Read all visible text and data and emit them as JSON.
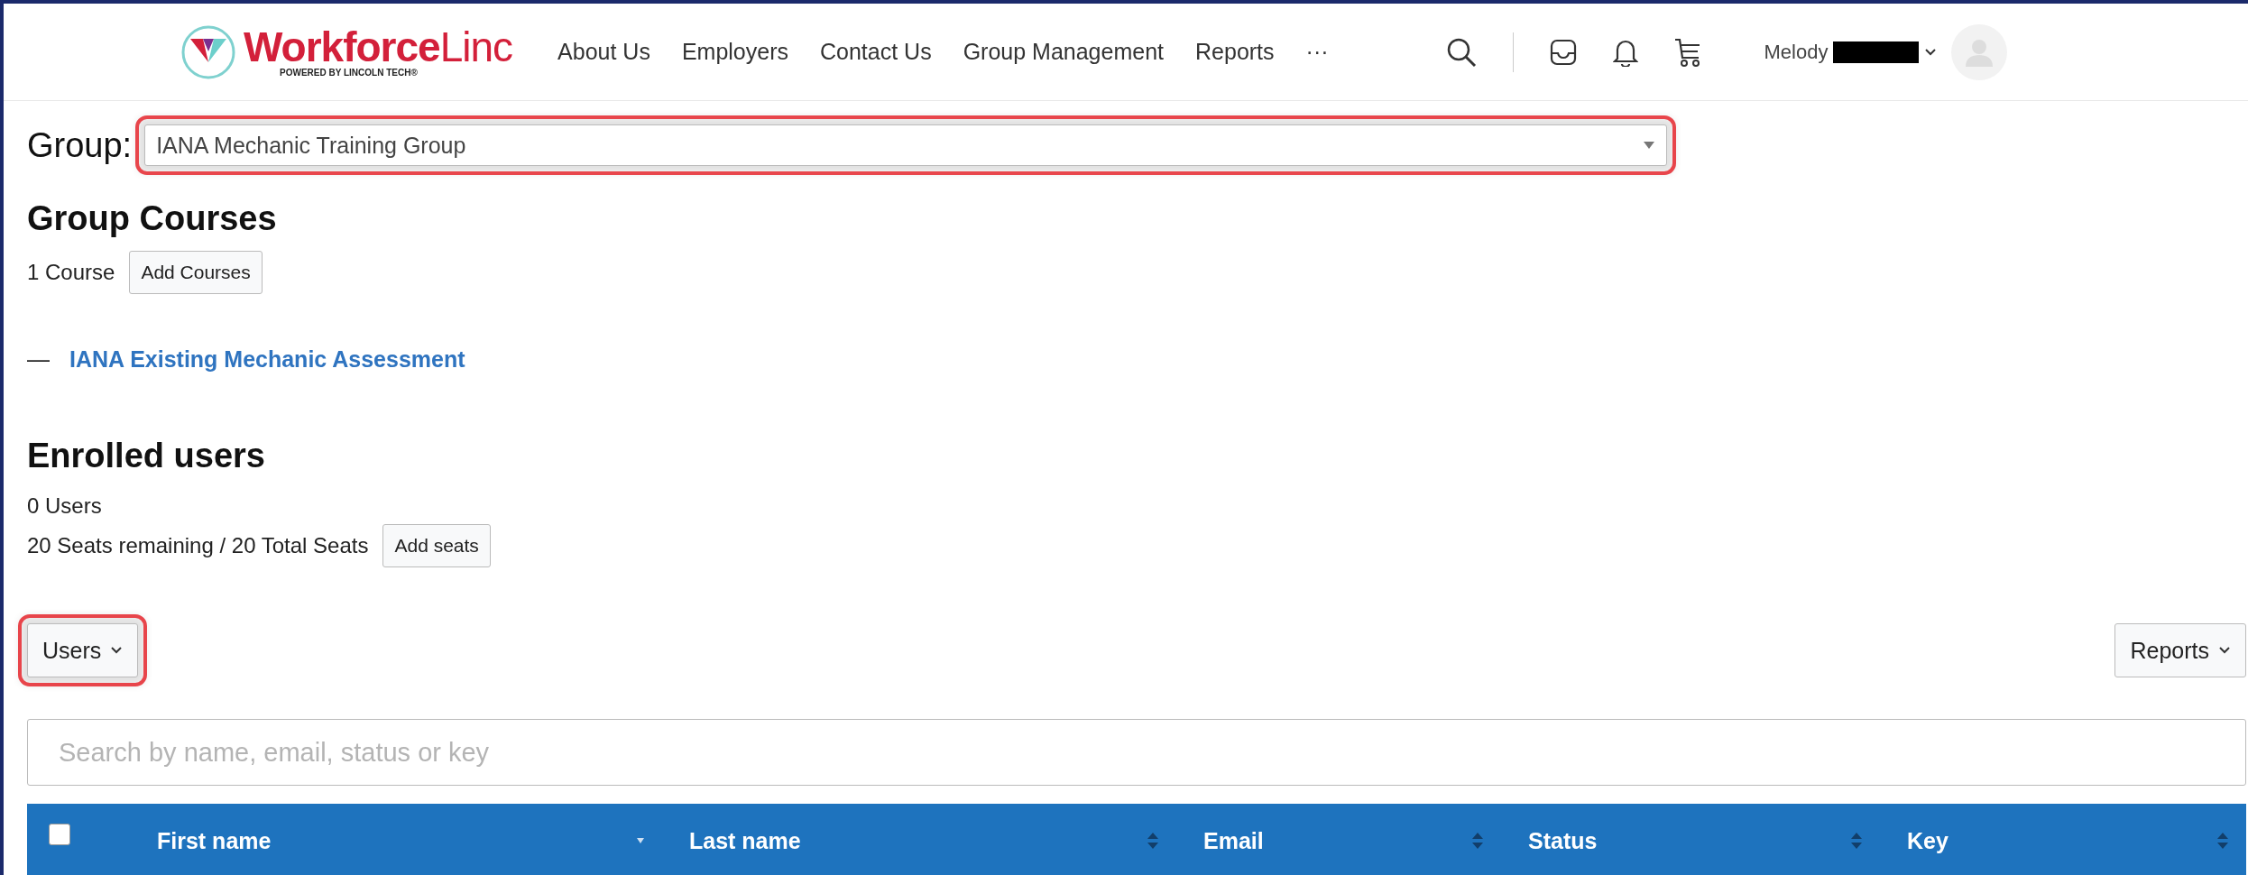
{
  "header": {
    "logo": {
      "name_part1": "Workforce",
      "name_part2": "Linc",
      "tagline": "POWERED BY LINCOLN TECH®"
    },
    "nav": [
      {
        "label": "About Us"
      },
      {
        "label": "Employers"
      },
      {
        "label": "Contact Us"
      },
      {
        "label": "Group Management"
      },
      {
        "label": "Reports"
      },
      {
        "label": "···"
      }
    ],
    "user": {
      "name": "Melody",
      "redacted": true
    }
  },
  "group": {
    "label": "Group:",
    "value": "IANA Mechanic Training Group",
    "highlighted": true
  },
  "courses": {
    "heading": "Group Courses",
    "count": "1 Course",
    "button": "Add Courses",
    "items": [
      {
        "dash": "—",
        "title": "IANA Existing Mechanic Assessment"
      }
    ]
  },
  "enrolled": {
    "heading": "Enrolled users",
    "count": "0 Users",
    "seats": "20 Seats remaining / 20 Total Seats",
    "button": "Add seats"
  },
  "toolbar": {
    "users_button": {
      "label": "Users",
      "highlighted": true
    },
    "reports_button": {
      "label": "Reports",
      "highlighted": false
    }
  },
  "search": {
    "placeholder": "Search by name, email, status or key"
  },
  "table": {
    "select_all": {
      "checked": false
    },
    "columns": [
      {
        "label": "First name",
        "sorted": true
      },
      {
        "label": "Last name",
        "sorted": false
      },
      {
        "label": "Email",
        "sorted": false
      },
      {
        "label": "Status",
        "sorted": false
      },
      {
        "label": "Key",
        "sorted": false
      }
    ]
  }
}
